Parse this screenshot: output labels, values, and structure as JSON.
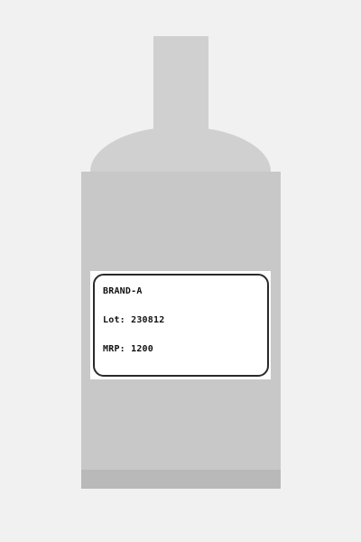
{
  "product": {
    "type": "bottle",
    "label": {
      "brand": "BRAND-A",
      "lot": "Lot: 230812",
      "mrp": "MRP: 1200"
    }
  },
  "colors": {
    "background": "#f1f1f1",
    "bottle": "#c8c8c8",
    "label": "#ffffff",
    "label_border": "#2a2a2a"
  }
}
